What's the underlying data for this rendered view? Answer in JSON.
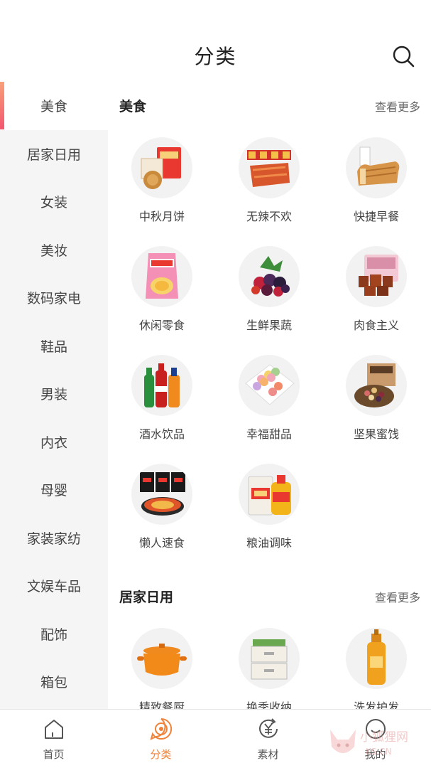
{
  "header": {
    "title": "分类"
  },
  "sidebar": {
    "items": [
      {
        "label": "美食"
      },
      {
        "label": "居家日用"
      },
      {
        "label": "女装"
      },
      {
        "label": "美妆"
      },
      {
        "label": "数码家电"
      },
      {
        "label": "鞋品"
      },
      {
        "label": "男装"
      },
      {
        "label": "内衣"
      },
      {
        "label": "母婴"
      },
      {
        "label": "家装家纺"
      },
      {
        "label": "文娱车品"
      },
      {
        "label": "配饰"
      },
      {
        "label": "箱包"
      }
    ],
    "active": "美食"
  },
  "sections": [
    {
      "title": "美食",
      "more": "查看更多",
      "items": [
        {
          "label": "中秋月饼",
          "icon": "mooncake-icon"
        },
        {
          "label": "无辣不欢",
          "icon": "spicy-strip-icon"
        },
        {
          "label": "快捷早餐",
          "icon": "bread-icon"
        },
        {
          "label": "休闲零食",
          "icon": "snack-bag-icon"
        },
        {
          "label": "生鲜果蔬",
          "icon": "berries-icon"
        },
        {
          "label": "肉食主义",
          "icon": "braised-meat-icon"
        },
        {
          "label": "酒水饮品",
          "icon": "drink-bottles-icon"
        },
        {
          "label": "幸福甜品",
          "icon": "macaron-icon"
        },
        {
          "label": "坚果蜜饯",
          "icon": "nuts-icon"
        },
        {
          "label": "懒人速食",
          "icon": "instant-noodle-icon"
        },
        {
          "label": "粮油调味",
          "icon": "rice-oil-icon"
        }
      ]
    },
    {
      "title": "居家日用",
      "more": "查看更多",
      "items": [
        {
          "label": "精致餐厨",
          "icon": "pot-icon"
        },
        {
          "label": "换季收纳",
          "icon": "storage-drawer-icon"
        },
        {
          "label": "洗发护发",
          "icon": "shampoo-icon"
        }
      ]
    }
  ],
  "tabbar": {
    "items": [
      {
        "label": "首页",
        "icon": "home-icon"
      },
      {
        "label": "分类",
        "icon": "category-icon"
      },
      {
        "label": "素材",
        "icon": "yuan-refresh-icon"
      },
      {
        "label": "我的",
        "icon": "smile-icon"
      }
    ],
    "active": "分类"
  },
  "watermark": {
    "text": "小狐狸网",
    "sub": "KS.CN"
  },
  "colors": {
    "accent": "#f0833a",
    "sidebar_bg": "#f5f5f5",
    "active_bar": "#f3566e"
  }
}
